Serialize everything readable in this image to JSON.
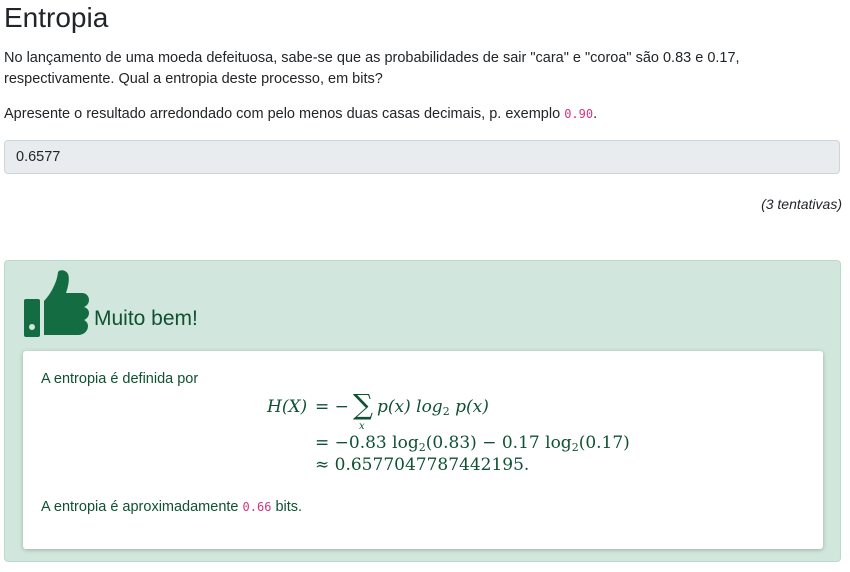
{
  "page": {
    "title": "Entropia",
    "question_text": "No lançamento de uma moeda defeituosa, sabe-se que as probabilidades de sair \"cara\" e \"coroa\" são 0.83 e 0.17, respectivamente. Qual a entropia deste processo, em bits?",
    "instruction_prefix": "Apresente o resultado arredondado com pelo menos duas casas decimais, p. exemplo ",
    "instruction_example": "0.90",
    "instruction_suffix": "."
  },
  "answer": {
    "value": "0.6577"
  },
  "attempts_label": "(3 tentativas)",
  "feedback": {
    "icon": "thumbs-up-icon",
    "title": "Muito bem!",
    "definition_text": "A entropia é definida por",
    "result_prefix": "A entropia é aproximadamente ",
    "result_value": "0.66",
    "result_suffix": " bits.",
    "colors": {
      "panel_bg": "#d1e7dd",
      "text": "#0f5132",
      "icon": "#146c43"
    }
  },
  "formula": {
    "lhs": "H(X)",
    "line1_rhs_a": "= −",
    "sigma_index": "x",
    "line1_rhs_b": "p(x) log",
    "line1_rhs_b2": "p(x)",
    "line2_a": "= −0.83 log",
    "line2_b": "(0.83) − 0.17 log",
    "line2_c": "(0.17)",
    "line3": "≈ 0.6577047787442195.",
    "log_base": "2"
  }
}
